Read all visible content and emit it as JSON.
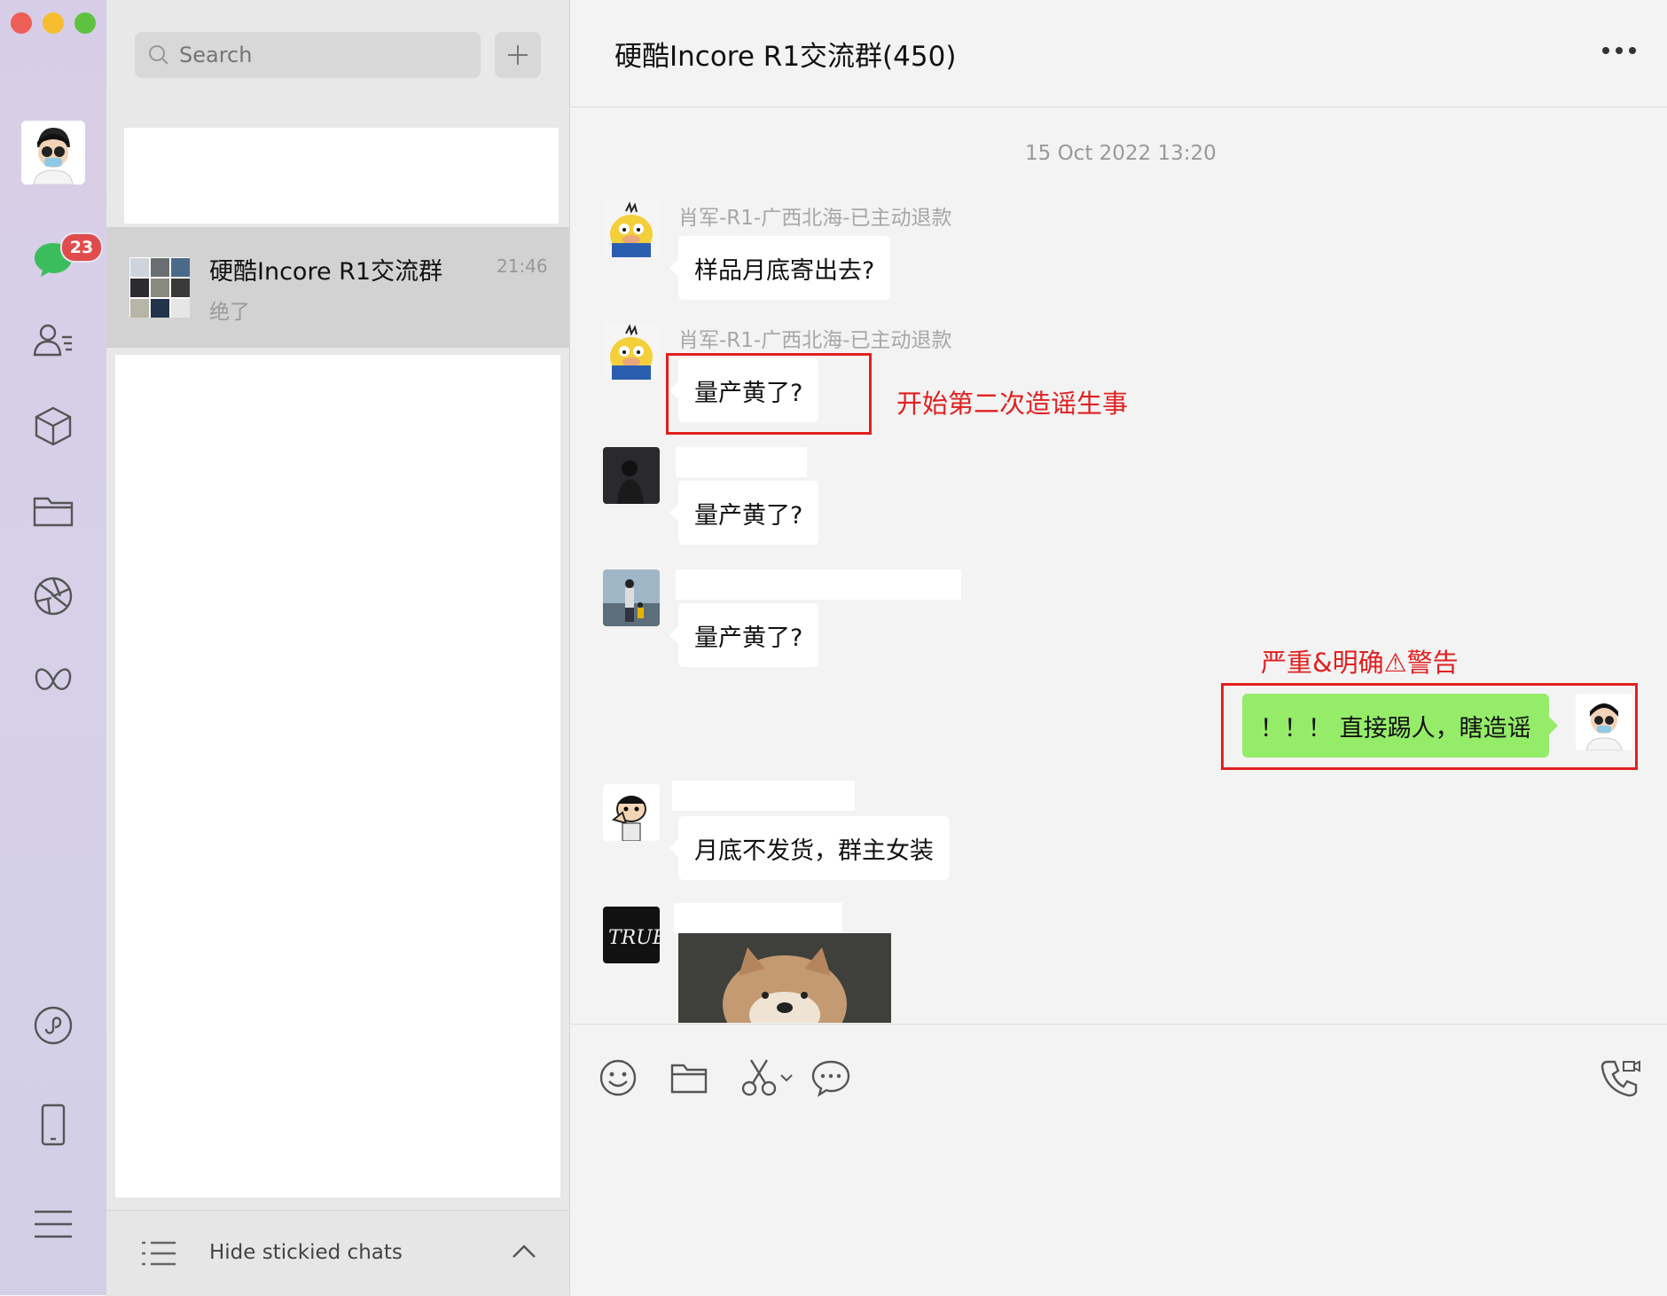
{
  "window": {
    "traffic_lights": {
      "close": "#ee5f57",
      "minimize": "#f5bd2f",
      "maximize": "#5ec140"
    }
  },
  "rail": {
    "unread_badge": "23",
    "icons": [
      "avatar",
      "chat-icon",
      "contacts-icon",
      "box-icon",
      "folder-icon",
      "moments-icon",
      "channels-icon",
      "miniprogram-icon",
      "phone-icon",
      "menu-icon"
    ]
  },
  "search": {
    "placeholder": "Search"
  },
  "chat_list": {
    "items": [
      {
        "name": "硬酷Incore R1交流群",
        "time": "21:46",
        "preview": "绝了"
      }
    ],
    "footer_label": "Hide stickied chats"
  },
  "chat": {
    "title": "硬酷Incore R1交流群(450)",
    "timestamp": "15 Oct 2022 13:20",
    "messages": [
      {
        "sender": "肖军-R1-广西北海-已主动退款",
        "text": "样品月底寄出去?"
      },
      {
        "sender": "肖军-R1-广西北海-已主动退款",
        "text": "量产黄了?"
      },
      {
        "sender": "",
        "text": "量产黄了?"
      },
      {
        "sender": "",
        "text": "量产黄了?"
      },
      {
        "sender": "me",
        "text": "！！！ 直接踢人，瞎造谣"
      },
      {
        "sender": "",
        "text": "月底不发货，群主女装"
      },
      {
        "sender": "",
        "text": "[image]"
      }
    ],
    "annotations": {
      "first": "开始第二次造谣生事",
      "second": "严重&明确⚠警告"
    }
  },
  "colors": {
    "accent_red": "#e02020",
    "my_bubble": "#95ec69",
    "badge": "#e04b4b"
  }
}
